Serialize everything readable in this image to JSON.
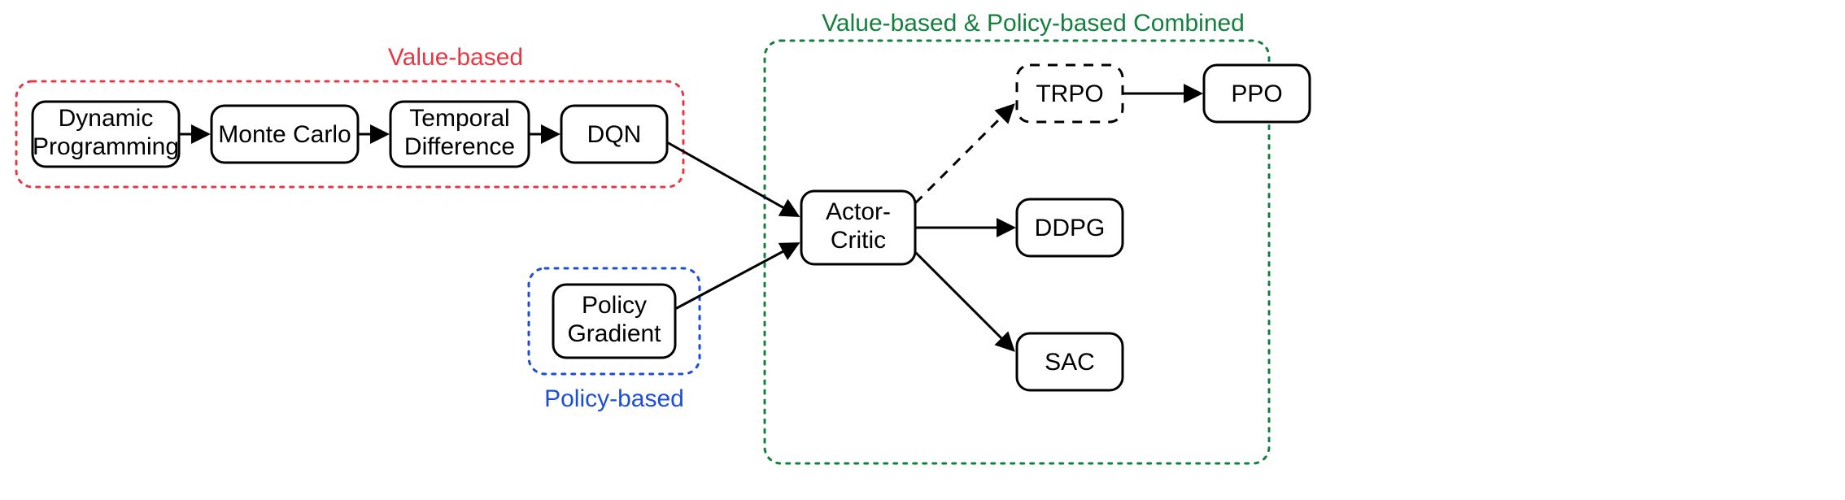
{
  "groups": {
    "value": {
      "label": "Value-based"
    },
    "policy": {
      "label": "Policy-based"
    },
    "combined": {
      "label": "Value-based & Policy-based Combined"
    }
  },
  "nodes": {
    "dp": {
      "line1": "Dynamic",
      "line2": "Programming"
    },
    "mc": {
      "label": "Monte Carlo"
    },
    "td": {
      "line1": "Temporal",
      "line2": "Difference"
    },
    "dqn": {
      "label": "DQN"
    },
    "pg": {
      "line1": "Policy",
      "line2": "Gradient"
    },
    "ac": {
      "line1": "Actor-",
      "line2": "Critic"
    },
    "trpo": {
      "label": "TRPO"
    },
    "ppo": {
      "label": "PPO"
    },
    "ddpg": {
      "label": "DDPG"
    },
    "sac": {
      "label": "SAC"
    }
  }
}
